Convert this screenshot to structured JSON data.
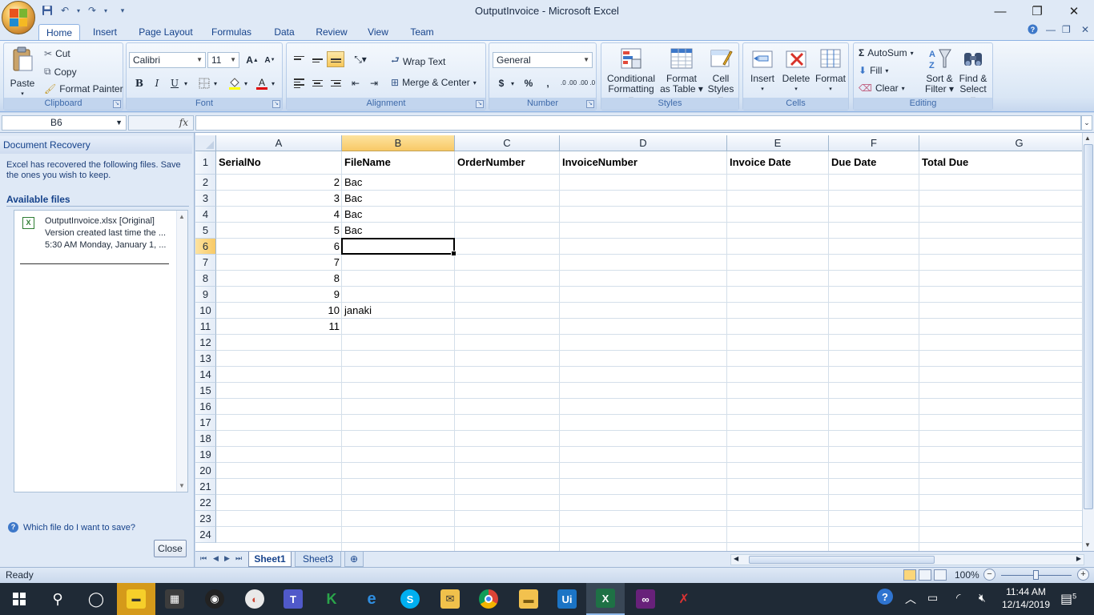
{
  "window": {
    "title": "OutputInvoice - Microsoft Excel",
    "minimize": "—",
    "restore": "❐",
    "close": "✕"
  },
  "ribbon_tabs": [
    "Home",
    "Insert",
    "Page Layout",
    "Formulas",
    "Data",
    "Review",
    "View",
    "Team"
  ],
  "active_tab": "Home",
  "clipboard": {
    "paste": "Paste",
    "cut": "Cut",
    "copy": "Copy",
    "format_painter": "Format Painter",
    "label": "Clipboard"
  },
  "font": {
    "name": "Calibri",
    "size": "11",
    "bold": "B",
    "italic": "I",
    "underline": "U",
    "label": "Font"
  },
  "alignment": {
    "wrap_text": "Wrap Text",
    "merge_center": "Merge & Center",
    "label": "Alignment"
  },
  "number": {
    "format": "General",
    "currency": "$",
    "percent": "%",
    "comma": ",",
    "inc_decimal": ".0 .00",
    "dec_decimal": ".00 .0",
    "label": "Number"
  },
  "styles": {
    "conditional": [
      "Conditional",
      "Formatting"
    ],
    "format_table": [
      "Format",
      "as Table"
    ],
    "cell_styles": [
      "Cell",
      "Styles"
    ],
    "label": "Styles"
  },
  "cells": {
    "insert": "Insert",
    "delete": "Delete",
    "format": "Format",
    "label": "Cells"
  },
  "editing": {
    "autosum": "AutoSum",
    "fill": "Fill",
    "clear": "Clear",
    "sort_filter": [
      "Sort &",
      "Filter"
    ],
    "find_select": [
      "Find &",
      "Select"
    ],
    "label": "Editing"
  },
  "formula_bar": {
    "name_box": "B6",
    "fx": "fx",
    "formula": ""
  },
  "recovery": {
    "title": "Document Recovery",
    "description": "Excel has recovered the following files.  Save the ones you wish to keep.",
    "available": "Available files",
    "file": {
      "name": "OutputInvoice.xlsx  [Original]",
      "line2": "Version created last time the ...",
      "line3": "5:30 AM Monday, January 1, ..."
    },
    "help": "Which file do I want to save?",
    "close": "Close"
  },
  "sheet": {
    "columns": [
      "A",
      "B",
      "C",
      "D",
      "E",
      "F",
      "G"
    ],
    "selected_column": "B",
    "selected_row": 6,
    "rows": [
      "1",
      "2",
      "3",
      "4",
      "5",
      "6",
      "7",
      "8",
      "9",
      "10",
      "11",
      "12",
      "13",
      "14",
      "15",
      "16",
      "17",
      "18",
      "19",
      "20",
      "21",
      "22",
      "23",
      "24"
    ],
    "headers": [
      "SerialNo",
      "FileName",
      "OrderNumber",
      "InvoiceNumber",
      "Invoice Date",
      "Due Date",
      "Total Due"
    ],
    "serials": [
      "2",
      "3",
      "4",
      "5",
      "6",
      "7",
      "8",
      "9",
      "10",
      "11"
    ],
    "filenames": [
      "Bac",
      "Bac",
      "Bac",
      "Bac",
      "",
      "",
      "",
      "",
      "janaki",
      ""
    ]
  },
  "sheet_tabs": [
    "Sheet1",
    "Sheet3"
  ],
  "status": {
    "text": "Ready",
    "zoom": "100%"
  },
  "taskbar": {
    "time": "11:44 AM",
    "date": "12/14/2019",
    "notifications": "5"
  }
}
